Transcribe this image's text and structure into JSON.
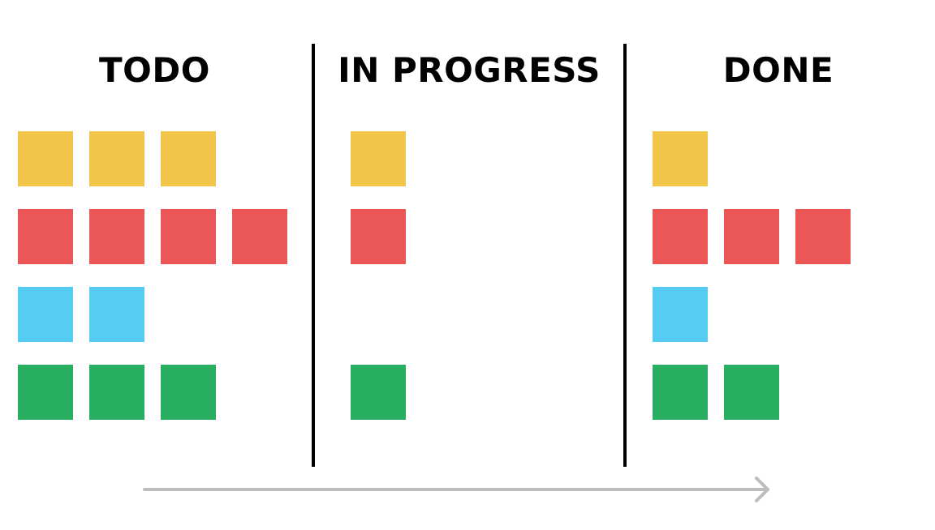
{
  "colors": {
    "yellow": "#F2C64A",
    "red": "#EB5757",
    "blue": "#56CCF2",
    "green": "#27AE60",
    "divider": "#000000",
    "arrow": "#BDBDBD"
  },
  "columns": [
    {
      "title": "TODO",
      "rows": [
        {
          "color": "yellow",
          "count": 3
        },
        {
          "color": "red",
          "count": 4
        },
        {
          "color": "blue",
          "count": 2
        },
        {
          "color": "green",
          "count": 3
        }
      ]
    },
    {
      "title": "IN PROGRESS",
      "rows": [
        {
          "color": "yellow",
          "count": 1
        },
        {
          "color": "red",
          "count": 1
        },
        {
          "color": "blue",
          "count": 0
        },
        {
          "color": "green",
          "count": 1
        }
      ]
    },
    {
      "title": "DONE",
      "rows": [
        {
          "color": "yellow",
          "count": 1
        },
        {
          "color": "red",
          "count": 3
        },
        {
          "color": "blue",
          "count": 1
        },
        {
          "color": "green",
          "count": 2
        }
      ]
    }
  ],
  "arrow": {
    "icon": "arrow-right-icon"
  }
}
